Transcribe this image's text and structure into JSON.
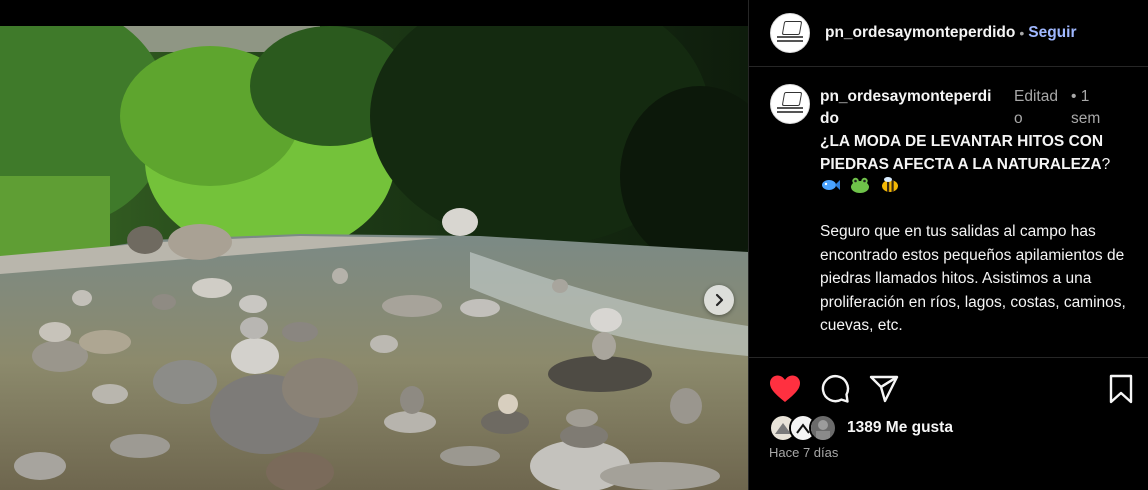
{
  "post": {
    "username": "pn_ordesaymonteperdido",
    "follow_label": "Seguir",
    "separator": "•",
    "caption": {
      "username_line1": "pn_ordesaymonteperdi",
      "username_line2": "do",
      "edited_line1": "Editad",
      "edited_line2": "o",
      "time_line1": "• 1",
      "time_line2": "sem",
      "title": "¿LA MODA DE LEVANTAR HITOS CON PIEDRAS AFECTA A LA NATURALEZA",
      "question_mark": "?",
      "emojis": [
        "fish-emoji",
        "frog-emoji",
        "bee-emoji"
      ],
      "body": "Seguro que en tus salidas al campo has encontrado estos pequeños apilamientos de piedras llamados hitos. Asistimos a una proliferación en ríos, lagos, costas, caminos, cuevas, etc."
    },
    "likes_label": "1389 Me gusta",
    "posted_ago": "Hace 7 días",
    "like_active": true
  },
  "icons": {
    "like": "heart-icon",
    "comment": "comment-icon",
    "share": "share-icon",
    "save": "bookmark-icon",
    "next": "chevron-right-icon"
  },
  "colors": {
    "accent_link": "#a0b8ff",
    "like_red": "#ff3040",
    "muted_text": "#a8a8a8",
    "background": "#000000"
  }
}
